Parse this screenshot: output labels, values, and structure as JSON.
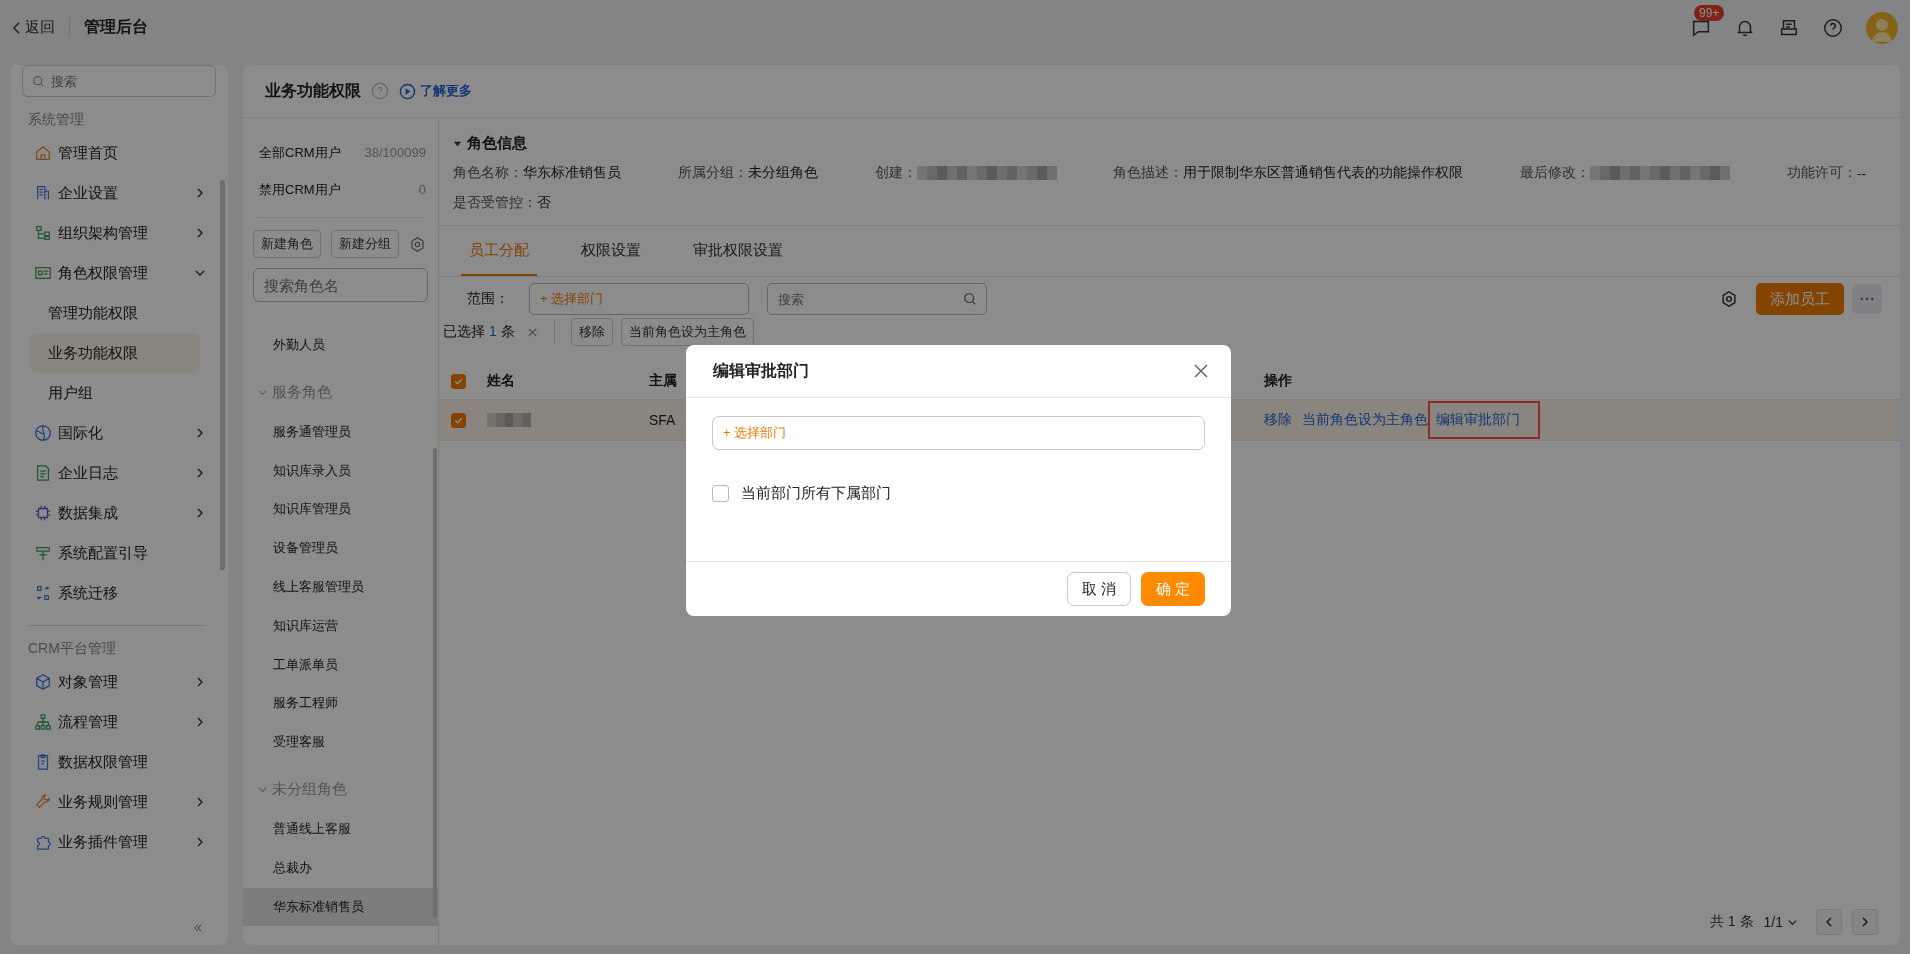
{
  "topbar": {
    "back": "返回",
    "title": "管理后台",
    "badge": "99+"
  },
  "sidebar": {
    "search_placeholder": "搜索",
    "sections": [
      {
        "title": "系统管理",
        "items": [
          {
            "label": "管理首页",
            "selected": false
          },
          {
            "label": "企业设置",
            "selected": false,
            "expanded": false
          },
          {
            "label": "组织架构管理",
            "selected": false,
            "expanded": false
          },
          {
            "label": "角色权限管理",
            "selected": false,
            "expanded": true,
            "children": [
              {
                "label": "管理功能权限",
                "selected": false
              },
              {
                "label": "业务功能权限",
                "selected": true
              },
              {
                "label": "用户组",
                "selected": false
              }
            ]
          },
          {
            "label": "国际化",
            "selected": false,
            "expanded": false
          },
          {
            "label": "企业日志",
            "selected": false,
            "expanded": false
          },
          {
            "label": "数据集成",
            "selected": false,
            "expanded": false
          },
          {
            "label": "系统配置引导",
            "selected": false
          },
          {
            "label": "系统迁移",
            "selected": false
          }
        ]
      },
      {
        "title": "CRM平台管理",
        "items": [
          {
            "label": "对象管理",
            "selected": false,
            "expanded": false
          },
          {
            "label": "流程管理",
            "selected": false,
            "expanded": false
          },
          {
            "label": "数据权限管理",
            "selected": false
          },
          {
            "label": "业务规则管理",
            "selected": false,
            "expanded": false
          },
          {
            "label": "业务插件管理",
            "selected": false,
            "expanded": false
          }
        ]
      }
    ]
  },
  "page_header": {
    "title": "业务功能权限",
    "link": "了解更多"
  },
  "roles": {
    "stats": [
      {
        "label": "全部CRM用户",
        "value": "38/100099"
      },
      {
        "label": "禁用CRM用户",
        "value": "0"
      }
    ],
    "buttons": [
      "新建角色",
      "新建分组"
    ],
    "search_placeholder": "搜索角色名",
    "groups": [
      {
        "items": [
          {
            "label": "外勤人员",
            "selected": false
          }
        ]
      },
      {
        "title": "服务角色",
        "expanded": true,
        "items": [
          {
            "label": "服务通管理员",
            "selected": false
          },
          {
            "label": "知识库录入员",
            "selected": false
          },
          {
            "label": "知识库管理员",
            "selected": false
          },
          {
            "label": "设备管理员",
            "selected": false
          },
          {
            "label": "线上客服管理员",
            "selected": false
          },
          {
            "label": "知识库运营",
            "selected": false
          },
          {
            "label": "工单派单员",
            "selected": false
          },
          {
            "label": "服务工程师",
            "selected": false
          },
          {
            "label": "受理客服",
            "selected": false
          }
        ]
      },
      {
        "title": "未分组角色",
        "expanded": true,
        "items": [
          {
            "label": "普通线上客服",
            "selected": false
          },
          {
            "label": "总裁办",
            "selected": false
          },
          {
            "label": "华东标准销售员",
            "selected": true
          }
        ]
      }
    ]
  },
  "role_info": {
    "title": "角色信息",
    "expanded": true,
    "fields": [
      {
        "label": "角色名称：",
        "kind": "text",
        "value": "华东标准销售员"
      },
      {
        "label": "所属分组：",
        "kind": "text",
        "value": "未分组角色"
      },
      {
        "label": "创建：",
        "kind": "redacted"
      },
      {
        "label": "角色描述：",
        "kind": "text",
        "value": "用于限制华东区普通销售代表的功能操作权限"
      },
      {
        "label": "最后修改：",
        "kind": "redacted"
      },
      {
        "label": "功能许可：",
        "kind": "text",
        "value": "--"
      },
      {
        "label": "是否受管控：",
        "kind": "text",
        "value": "否"
      }
    ]
  },
  "tabs": [
    {
      "label": "员工分配",
      "selected": true
    },
    {
      "label": "权限设置",
      "selected": false
    },
    {
      "label": "审批权限设置",
      "selected": false
    }
  ],
  "toolbar": {
    "scope_label": "范围：",
    "department_select": "+ 选择部门",
    "search_placeholder": "搜索",
    "add_button": "添加员工"
  },
  "selection": {
    "prefix": "已选择",
    "count": "1",
    "suffix": "条",
    "buttons": [
      "移除",
      "当前角色设为主角色"
    ]
  },
  "table": {
    "all_selected": true,
    "columns": [
      "姓名",
      "主属",
      "操作"
    ],
    "rows": [
      {
        "selected": true,
        "column_2": "SFA",
        "actions": [
          {
            "label": "移除",
            "highlighted": false
          },
          {
            "label": "当前角色设为主角色",
            "highlighted": false
          },
          {
            "label": "编辑审批部门",
            "highlighted": true
          }
        ]
      }
    ]
  },
  "pagination": {
    "total": "共 1 条",
    "page": "1/1"
  },
  "dialog": {
    "title": "编辑审批部门",
    "department_select": "+ 选择部门",
    "checkbox": {
      "label": "当前部门所有下属部门",
      "checked": false
    },
    "buttons": [
      {
        "label": "取 消",
        "kind": "default"
      },
      {
        "label": "确 定",
        "kind": "primary"
      }
    ]
  }
}
